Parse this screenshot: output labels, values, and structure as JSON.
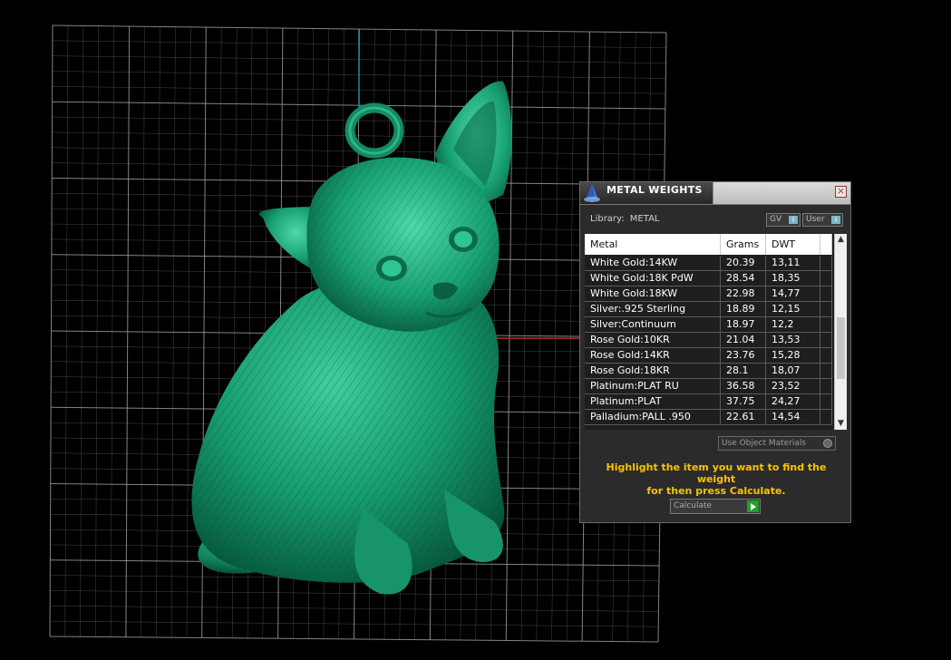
{
  "window": {
    "title": "METAL WEIGHTS",
    "library_label": "Library:",
    "library_value": "METAL",
    "toggle_gv": "GV",
    "toggle_user": "User",
    "toggle_knob": "I"
  },
  "table": {
    "headers": [
      "Metal",
      "Grams",
      "DWT"
    ],
    "rows": [
      {
        "metal": "White Gold:14KW",
        "grams": "20.39",
        "dwt": "13,11"
      },
      {
        "metal": "White Gold:18K PdW",
        "grams": "28.54",
        "dwt": "18,35"
      },
      {
        "metal": "White Gold:18KW",
        "grams": "22.98",
        "dwt": "14,77"
      },
      {
        "metal": "Silver:.925 Sterling",
        "grams": "18.89",
        "dwt": "12,15"
      },
      {
        "metal": "Silver:Continuum",
        "grams": "18.97",
        "dwt": "12,2"
      },
      {
        "metal": "Rose Gold:10KR",
        "grams": "21.04",
        "dwt": "13,53"
      },
      {
        "metal": "Rose Gold:14KR",
        "grams": "23.76",
        "dwt": "15,28"
      },
      {
        "metal": "Rose Gold:18KR",
        "grams": "28.1",
        "dwt": "18,07"
      },
      {
        "metal": "Platinum:PLAT RU",
        "grams": "36.58",
        "dwt": "23,52"
      },
      {
        "metal": "Platinum:PLAT",
        "grams": "37.75",
        "dwt": "24,27"
      },
      {
        "metal": "Palladium:PALL .950",
        "grams": "22.61",
        "dwt": "14,54"
      }
    ]
  },
  "use_object_materials": "Use Object Materials",
  "hint_line1": "Highlight the item you want to find the weight",
  "hint_line2": "for then press Calculate.",
  "calculate_label": "Calculate",
  "colors": {
    "model": "#1a8a6a",
    "hint": "#f7c400",
    "grid": "#9a9a9a"
  }
}
